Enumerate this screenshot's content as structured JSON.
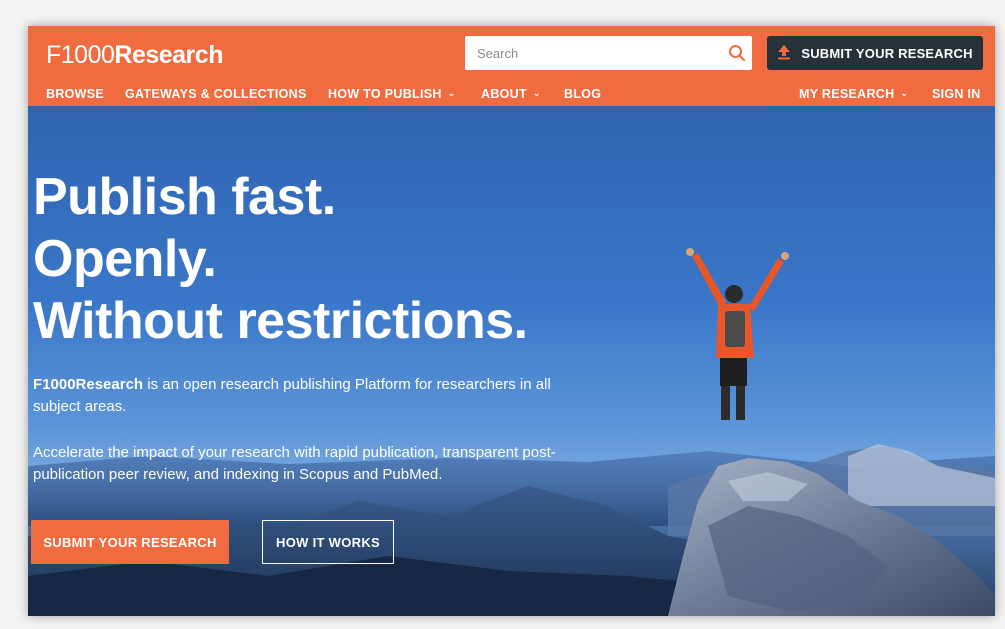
{
  "header": {
    "logo_thin": "F1000",
    "logo_bold": "Research",
    "search_placeholder": "Search",
    "submit_label": "SUBMIT YOUR RESEARCH"
  },
  "nav": {
    "left": [
      {
        "label": "BROWSE"
      },
      {
        "label": "GATEWAYS & COLLECTIONS"
      },
      {
        "label": "HOW TO PUBLISH"
      },
      {
        "label": "ABOUT"
      },
      {
        "label": "BLOG"
      }
    ],
    "right": [
      {
        "label": "MY RESEARCH"
      },
      {
        "label": "SIGN IN"
      }
    ]
  },
  "hero": {
    "headline": [
      "Publish fast.",
      "Openly.",
      "Without restrictions."
    ],
    "brand": "F1000Research",
    "intro_rest": " is an open research publishing Platform for researchers in all subject areas.",
    "paragraph2": "Accelerate the impact of your research with rapid publication, transparent post-publication peer review, and indexing in Scopus and PubMed.",
    "primary_button": "SUBMIT YOUR RESEARCH",
    "secondary_button": "HOW IT WORKS"
  },
  "colors": {
    "brand_orange": "#f06b3f",
    "dark_button": "#263238"
  }
}
